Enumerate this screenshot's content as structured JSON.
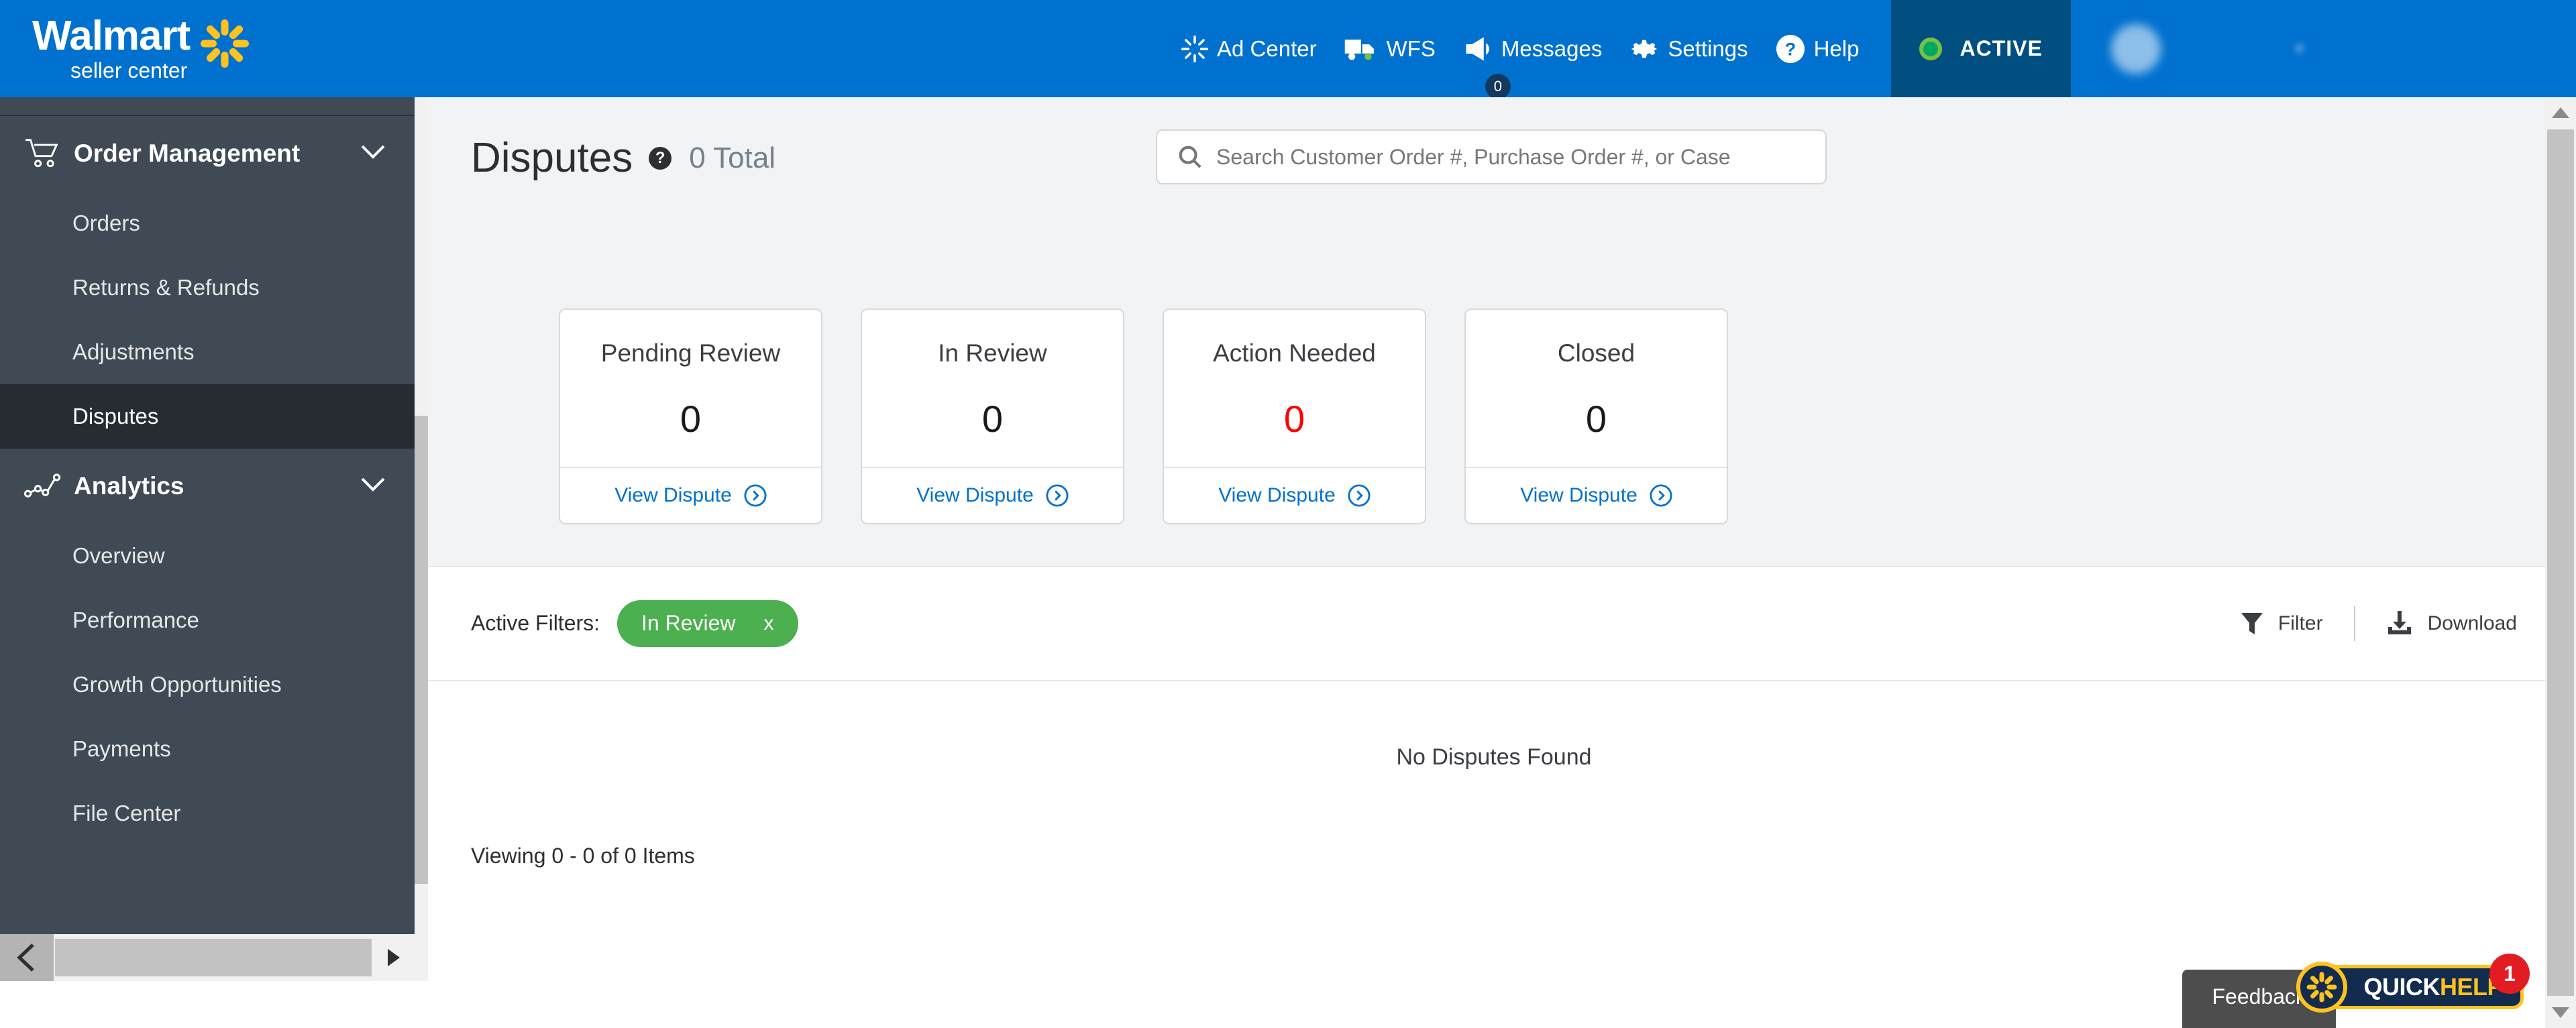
{
  "brand": {
    "name": "Walmart",
    "subtitle": "seller center",
    "primary_color": "#0071CE",
    "spark_color": "#FFC220"
  },
  "topnav": {
    "items": [
      {
        "label": "Ad Center",
        "icon": "spark-icon"
      },
      {
        "label": "WFS",
        "icon": "truck-icon"
      },
      {
        "label": "Messages",
        "icon": "megaphone-icon",
        "badge": "0"
      },
      {
        "label": "Settings",
        "icon": "gear-icon"
      },
      {
        "label": "Help",
        "icon": "question-circle-icon"
      }
    ],
    "status": {
      "label": "ACTIVE",
      "dot_color": "#00A862",
      "background": "#004F80"
    },
    "user": {
      "name": "",
      "caret": "▾"
    }
  },
  "sidebar": {
    "sections": [
      {
        "label": "Order Management",
        "icon": "shopping-cart-icon",
        "expanded": true,
        "chevron": "⌄",
        "items": [
          {
            "label": "Orders",
            "active": false
          },
          {
            "label": "Returns & Refunds",
            "active": false
          },
          {
            "label": "Adjustments",
            "active": false
          },
          {
            "label": "Disputes",
            "active": true
          }
        ]
      },
      {
        "label": "Analytics",
        "icon": "line-chart-icon",
        "expanded": true,
        "chevron": "⌄",
        "items": [
          {
            "label": "Overview",
            "active": false
          },
          {
            "label": "Performance",
            "active": false
          },
          {
            "label": "Growth Opportunities",
            "active": false
          },
          {
            "label": "Payments",
            "active": false
          },
          {
            "label": "File Center",
            "active": false
          }
        ]
      }
    ],
    "collapse_icon": "chevron-left-icon",
    "scroll_right_icon": "triangle-right-icon"
  },
  "page": {
    "title": "Disputes",
    "help_icon": "question-mark-icon",
    "total_label": "0 Total"
  },
  "search": {
    "placeholder": "Search Customer Order #, Purchase Order #, or Case",
    "value": "",
    "icon": "search-icon"
  },
  "status_cards": [
    {
      "title": "Pending Review",
      "value": "0",
      "value_color": "#1A1A1A",
      "link_label": "View Dispute",
      "link_icon": "arrow-right-circle-icon"
    },
    {
      "title": "In Review",
      "value": "0",
      "value_color": "#1A1A1A",
      "link_label": "View Dispute",
      "link_icon": "arrow-right-circle-icon"
    },
    {
      "title": "Action Needed",
      "value": "0",
      "value_color": "#FF0000",
      "link_label": "View Dispute",
      "link_icon": "arrow-right-circle-icon"
    },
    {
      "title": "Closed",
      "value": "0",
      "value_color": "#1A1A1A",
      "link_label": "View Dispute",
      "link_icon": "arrow-right-circle-icon"
    }
  ],
  "filter_bar": {
    "active_filters_label": "Active Filters:",
    "chips": [
      {
        "label": "In Review",
        "remove": "x",
        "color": "#4CAF50"
      }
    ],
    "filter_button": {
      "label": "Filter",
      "icon": "funnel-icon"
    },
    "download_button": {
      "label": "Download",
      "icon": "download-icon"
    }
  },
  "table": {
    "empty_message": "No Disputes Found",
    "viewing_text": "Viewing 0 - 0 of 0 Items"
  },
  "widgets": {
    "feedback_label": "Feedback",
    "quickhelp": {
      "quick": "QUICK",
      "help": "HELP",
      "count": "1",
      "count_color": "#E31C23"
    }
  },
  "scrollbars": {
    "up_arrow": "triangle-up-icon",
    "down_arrow": "triangle-down-icon"
  }
}
